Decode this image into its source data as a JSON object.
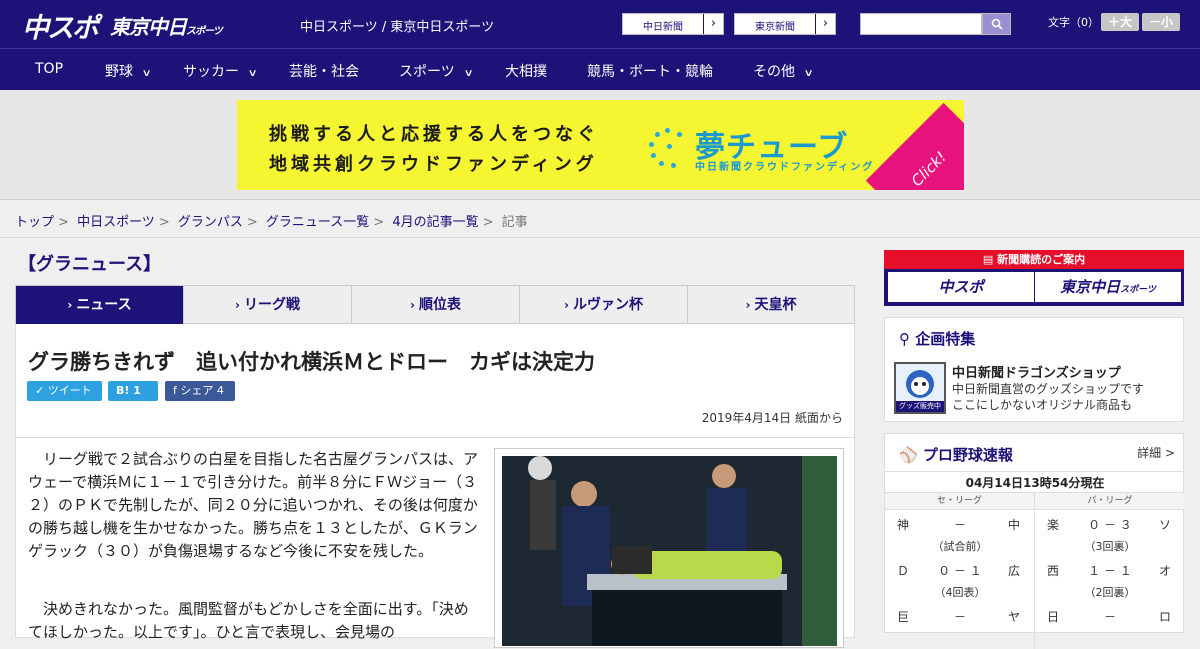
{
  "header": {
    "logo_chuspo": "中スポ",
    "logo_tokyo": "東京中日",
    "logo_tokyo_small": "スポーツ",
    "site_title": "中日スポーツ / 東京中日スポーツ",
    "select1": "中日新聞",
    "select2": "東京新聞",
    "fontsize_label": "文字（0）",
    "fontsize_up": "＋大",
    "fontsize_down": "－小"
  },
  "nav": [
    {
      "label": "TOP"
    },
    {
      "label": "野球"
    },
    {
      "label": "サッカー"
    },
    {
      "label": "芸能・社会"
    },
    {
      "label": "スポーツ"
    },
    {
      "label": "大相撲"
    },
    {
      "label": "競馬・ボート・競輪"
    },
    {
      "label": "その他"
    }
  ],
  "banner": {
    "line1": "挑戦する人と応援する人をつなぐ",
    "line2": "地域共創クラウドファンディング",
    "logo": "夢チューブ",
    "sub": "中日新聞クラウドファンディング",
    "click": "Click!"
  },
  "breadcrumb": [
    "トップ",
    "中日スポーツ",
    "グランパス",
    "グラニュース一覧",
    "4月の記事一覧"
  ],
  "breadcrumb_current": "記事",
  "section_title": "【グラニュース】",
  "tabs": [
    "ニュース",
    "リーグ戦",
    "順位表",
    "ルヴァン杯",
    "天皇杯"
  ],
  "article": {
    "title": "グラ勝ちきれず　追い付かれ横浜Ｍとドロー　カギは決定力",
    "share_tweet": "ツイート",
    "share_hatena": "B! 1",
    "share_fb": "シェア 4",
    "date": "2019年4月14日 紙面から",
    "para1": "リーグ戦で２試合ぶりの白星を目指した名古屋グランパスは、アウェーで横浜Ｍに１－１で引き分けた。前半８分にＦＷジョー（３２）のＰＫで先制したが、同２０分に追いつかれ、その後は何度かの勝ち越し機を生かせなかった。勝ち点を１３としたが、ＧＫランゲラック（３０）が負傷退場するなど今後に不安を残した。",
    "para2": "決めきれなかった。風間監督がもどかしさを全面に出す。「決めてほしかった。以上です」。ひと言で表現し、会見場の"
  },
  "sidebar": {
    "sub_head": "新聞購読のご案内",
    "sub_btn1": "中スポ",
    "sub_btn2": "東京中日",
    "plan_title": "企画特集",
    "plan_name": "中日新聞ドラゴンズショップ",
    "plan_desc1": "中日新聞直営のグッズショップです",
    "plan_desc2": "ここにしかないオリジナル商品も",
    "plan_badge": "グッズ販売中",
    "bb_title": "プロ野球速報",
    "bb_more": "詳細 >",
    "bb_time": "04月14日13時54分現在",
    "central": "セ・リーグ",
    "pacific": "パ・リーグ",
    "games_central": [
      {
        "t1": "神",
        "score": "－",
        "t2": "中",
        "inning": "（試合前）"
      },
      {
        "t1": "Ｄ",
        "score": "０ － １",
        "t2": "広",
        "inning": "（4回表）"
      },
      {
        "t1": "巨",
        "score": "－",
        "t2": "ヤ",
        "inning": ""
      }
    ],
    "games_pacific": [
      {
        "t1": "楽",
        "score": "０ － ３",
        "t2": "ソ",
        "inning": "（3回裏）"
      },
      {
        "t1": "西",
        "score": "１ － １",
        "t2": "オ",
        "inning": "（2回裏）"
      },
      {
        "t1": "日",
        "score": "－",
        "t2": "ロ",
        "inning": ""
      }
    ]
  }
}
